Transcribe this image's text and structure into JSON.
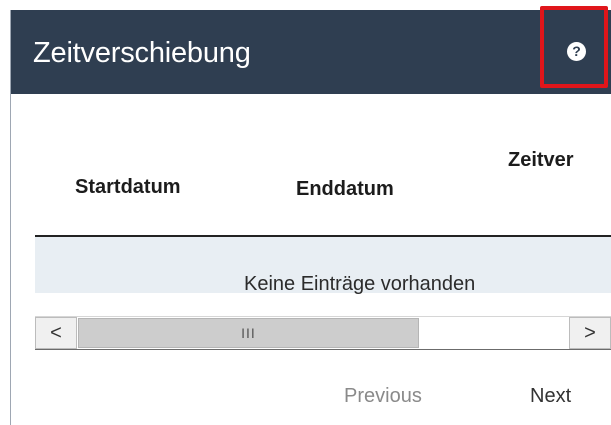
{
  "panel": {
    "title": "Zeitverschiebung",
    "help_icon": "question-circle-icon",
    "help_glyph": "?",
    "header_color": "#2f3e51",
    "highlight_color": "#e0161b"
  },
  "table": {
    "columns": [
      "Startdatum",
      "Enddatum",
      "Zeitver"
    ],
    "empty_message": "Keine Einträge vorhanden",
    "empty_row_color": "#e8eef3"
  },
  "scrollbar": {
    "left_arrow": "<",
    "right_arrow": ">",
    "thumb_grip": "III"
  },
  "pagination": {
    "previous_label": "Previous",
    "next_label": "Next"
  }
}
